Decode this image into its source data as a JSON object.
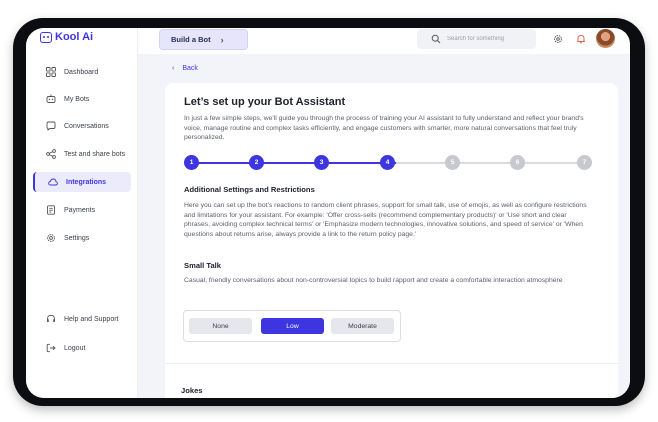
{
  "app": {
    "name": "Kool Ai"
  },
  "sidebar": {
    "items": [
      {
        "label": "Dashboard",
        "icon": "grid-icon"
      },
      {
        "label": "My Bots",
        "icon": "bot-icon"
      },
      {
        "label": "Conversations",
        "icon": "chat-icon"
      },
      {
        "label": "Test and share bots",
        "icon": "share-icon"
      },
      {
        "label": "Integrations",
        "icon": "cloud-icon",
        "active": true
      },
      {
        "label": "Payments",
        "icon": "receipt-icon"
      },
      {
        "label": "Settings",
        "icon": "gear-icon"
      }
    ],
    "bottom_items": [
      {
        "label": "Help and Support",
        "icon": "headset-icon"
      },
      {
        "label": "Logout",
        "icon": "logout-icon"
      }
    ]
  },
  "topbar": {
    "build_label": "Build a Bot",
    "search_placeholder": "Search for something"
  },
  "page": {
    "back_label": "Back",
    "title": "Let’s set up your Bot Assistant",
    "intro": "In just a few simple steps, we'll guide you through the process of training your AI assistant to fully understand and reflect your brand's voice, manage routine and complex tasks efficiently, and engage customers with smarter, more natural conversations that feel truly personalized.",
    "steps": {
      "labels": [
        "1",
        "2",
        "3",
        "4",
        "5",
        "6",
        "7"
      ],
      "current": 4
    },
    "additional": {
      "title": "Additional Settings and Restrictions",
      "text": "Here you can set up the bot’s reactions to random client phrases, support for small talk, use of emojis, as well as configure restrictions and limitations for your assistant. For example: 'Offer cross-sells (recommend complementary products)' or 'Use short and clear phrases, avoiding complex technical terms' or 'Emphasize modern technologies, innovative solutions, and speed of service' or 'When questions about returns arise, always provide a link to the return policy page.'"
    },
    "small_talk": {
      "title": "Small Talk",
      "text": "Casual, friendly conversations about non-controversial topics to build rapport and create a comfortable interaction atmosphere",
      "options": [
        "None",
        "Low",
        "Moderate"
      ],
      "selected": "Low"
    },
    "jokes": {
      "title": "Jokes"
    }
  },
  "colors": {
    "accent": "#3d35e0",
    "inactive_step": "#c8c9cf",
    "background": "#f3f4f9"
  }
}
